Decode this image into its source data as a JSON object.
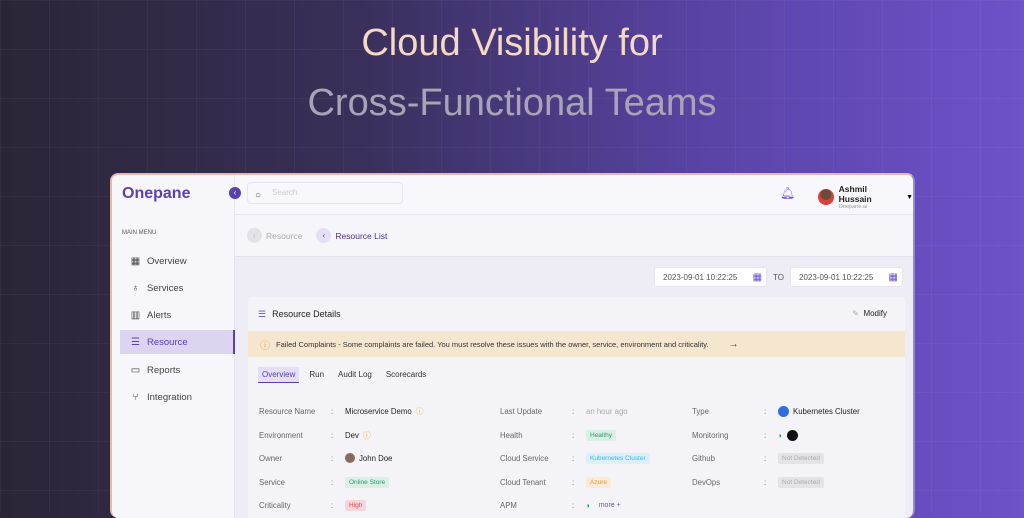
{
  "hero": {
    "line1": "Cloud Visibility for",
    "line2": "Cross-Functional Teams"
  },
  "sidebar": {
    "logo": "Onepane",
    "section": "MAIN MENU",
    "items": [
      {
        "label": "Overview",
        "icon": "grid-icon"
      },
      {
        "label": "Services",
        "icon": "services-icon"
      },
      {
        "label": "Alerts",
        "icon": "chart-icon"
      },
      {
        "label": "Resource",
        "icon": "database-icon",
        "active": true
      },
      {
        "label": "Reports",
        "icon": "laptop-icon"
      },
      {
        "label": "Integration",
        "icon": "integration-icon"
      }
    ]
  },
  "header": {
    "search_placeholder": "Search",
    "user_name": "Ashmil Hussain",
    "user_org": "Onepane.ai"
  },
  "breadcrumb": {
    "back": "Resource",
    "current": "Resource List"
  },
  "dates": {
    "from": "2023-09-01  10:22:25",
    "sep": "TO",
    "to": "2023-09-01  10:22:25"
  },
  "card": {
    "title": "Resource Details",
    "modify": "Modify",
    "warning": {
      "title": "Failed Complaints",
      "text": " - Some complaints are failed. You must resolve these issues with the owner, service, environment and criticality."
    },
    "tabs": [
      "Overview",
      "Run",
      "Audit Log",
      "Scorecards"
    ],
    "fields": {
      "resource_name": {
        "label": "Resource Name",
        "value": "Microservice Demo"
      },
      "environment": {
        "label": "Environment",
        "value": "Dev"
      },
      "owner": {
        "label": "Owner",
        "value": "John Doe"
      },
      "service": {
        "label": "Service",
        "value": "Online Store"
      },
      "criticality": {
        "label": "Criticality",
        "value": "High"
      },
      "last_update": {
        "label": "Last Update",
        "value": "an hour ago"
      },
      "health": {
        "label": "Health",
        "value": "Healthy"
      },
      "cloud_service": {
        "label": "Cloud Service",
        "value": "Kubernetes Cluster"
      },
      "cloud_tenant": {
        "label": "Cloud Tenant",
        "value": "Azure"
      },
      "apm": {
        "label": "APM",
        "value": "more +"
      },
      "type": {
        "label": "Type",
        "value": "Kubernetes Cluster"
      },
      "monitoring": {
        "label": "Monitoring"
      },
      "github": {
        "label": "Github",
        "value": "Not Detected"
      },
      "devops": {
        "label": "DevOps",
        "value": "Not Detected"
      }
    },
    "colon": ":"
  }
}
